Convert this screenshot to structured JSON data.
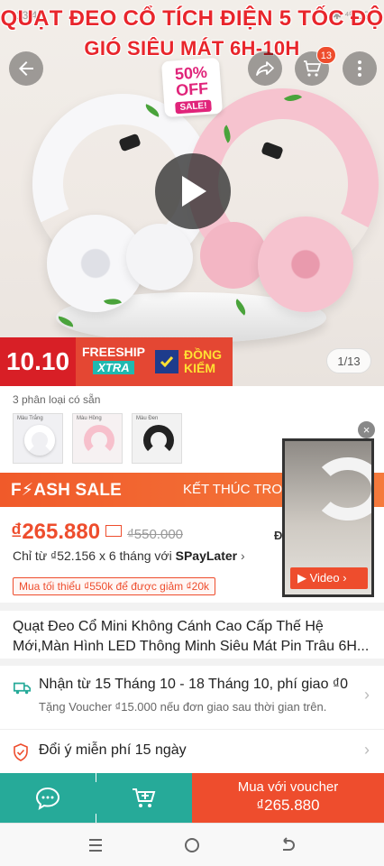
{
  "status_bar": {
    "time": "13:48",
    "icons": "✱ ⁴ᴳ 39"
  },
  "hero": {
    "banner_line1": "QUẠT ĐEO CỔ TÍCH ĐIỆN 5 TỐC ĐỘ",
    "banner_line2": "GIÓ SIÊU MÁT 6H-10H",
    "sale_percent": "50%",
    "sale_off": "OFF",
    "sale_word": "SALE!",
    "cart_count": "13",
    "image_counter": "1/13",
    "promo_1010": "10.10",
    "promo_freeship": "FREESHIP",
    "promo_xtra": "XTRA",
    "promo_dongkiem_1": "ĐỒNG",
    "promo_dongkiem_2": "KIỂM"
  },
  "variants": {
    "label": "3 phân loại có sẵn",
    "items": [
      {
        "name": "Màu Trắng",
        "color": "#ffffff",
        "bg": "#f0f0f3"
      },
      {
        "name": "Màu Hồng",
        "color": "#f7c0cc",
        "bg": "#f6f1f2"
      },
      {
        "name": "Màu Đen",
        "color": "#222222",
        "bg": "#f2f2f2"
      }
    ]
  },
  "flash_sale": {
    "title": "F⚡ASH SALE",
    "ends_label": "KẾT THÚC TRONG"
  },
  "pricing": {
    "current": "₫265.880",
    "original": "₫550.000",
    "side_text": "Đ",
    "installment": "Chỉ từ ₫52.156 x 6 tháng với ",
    "installment_brand": "SPayLater",
    "min_order": "Mua tối thiểu ₫550k để được giảm ₫20k"
  },
  "mini_video": {
    "label": "Video"
  },
  "product": {
    "title": "Quạt Đeo Cổ Mini Không Cánh Cao Cấp Thế Hệ Mới,Màn Hình LED Thông Minh Siêu Mát Pin Trâu 6H..."
  },
  "shipping": {
    "main": "Nhận từ 15 Tháng 10 - 18 Tháng 10, phí giao ₫0",
    "sub": "Tặng Voucher ₫15.000 nếu đơn giao sau thời gian trên."
  },
  "returns": {
    "text": "Đổi ý miễn phí 15 ngày"
  },
  "bottom_bar": {
    "buy_line1": "Mua với voucher",
    "buy_line2": "₫265.880"
  },
  "colors": {
    "brand": "#ee4d2d",
    "teal": "#26aa99",
    "banner_red": "#e8262c"
  }
}
